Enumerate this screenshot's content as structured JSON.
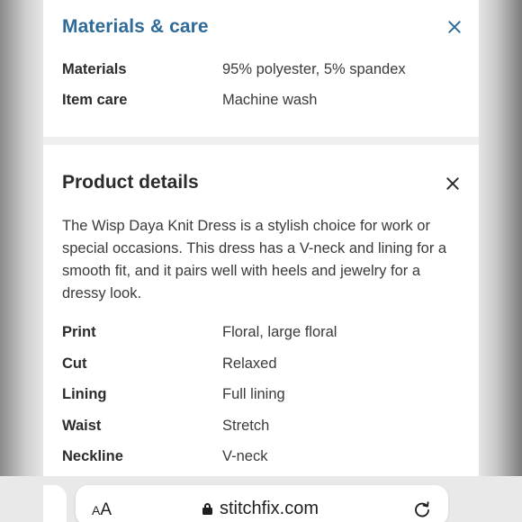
{
  "materials_care": {
    "title": "Materials & care",
    "rows": [
      {
        "label": "Materials",
        "value": "95% polyester, 5% spandex"
      },
      {
        "label": "Item care",
        "value": "Machine wash"
      }
    ]
  },
  "product_details": {
    "title": "Product details",
    "description": "The Wisp Daya Knit Dress is a stylish choice for work or special occasions. This dress has a V-neck and lining for a smooth fit, and it pairs well with heels and jewelry for a dressy look.",
    "rows": [
      {
        "label": "Print",
        "value": "Floral, large floral"
      },
      {
        "label": "Cut",
        "value": "Relaxed"
      },
      {
        "label": "Lining",
        "value": "Full lining"
      },
      {
        "label": "Waist",
        "value": "Stretch"
      },
      {
        "label": "Neckline",
        "value": "V-neck"
      }
    ]
  },
  "browser": {
    "text_size_small": "A",
    "text_size_large": "A",
    "domain": "stitchfix.com",
    "icons": [
      "lock-icon",
      "reload-icon"
    ]
  },
  "colors": {
    "accent_blue": "#2f6b99",
    "text_dark": "#2b2b2b"
  }
}
